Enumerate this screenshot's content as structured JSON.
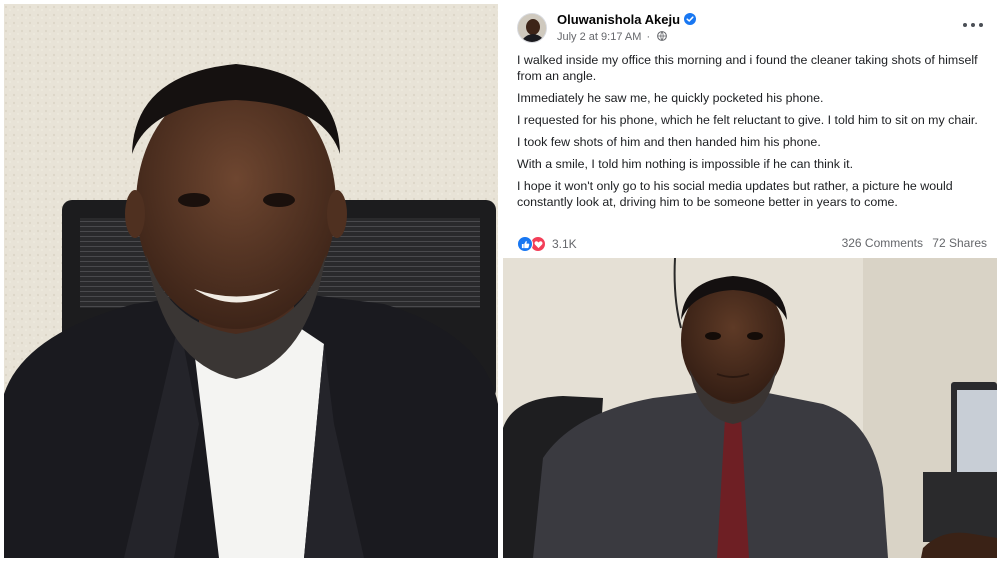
{
  "post": {
    "author": "Oluwanishola Akeju",
    "timestamp": "July 2 at 9:17 AM",
    "separator": "·",
    "paragraphs": [
      "I walked inside my office this morning and i found the cleaner taking shots of himself from an angle.",
      "Immediately he saw me, he quickly pocketed his phone.",
      "I requested for his phone, which he felt reluctant to give. I told him to sit on my chair.",
      "I took few shots of him and then handed him his phone.",
      "With a smile, I told him nothing is impossible if he can think it.",
      "I hope it won't only go to his social media updates but rather, a picture he would constantly look at, driving him to be someone better in years to come."
    ],
    "reaction_count": "3.1K",
    "comments": "326 Comments",
    "shares": "72 Shares"
  },
  "icons": {
    "verified": "verified-badge-icon",
    "privacy": "globe-icon",
    "more": "more-options-icon",
    "like": "like-icon",
    "love": "love-icon"
  },
  "colors": {
    "facebook_blue": "#1877f2",
    "love_red": "#f33e58",
    "text_primary": "#050505",
    "text_secondary": "#65676b"
  }
}
